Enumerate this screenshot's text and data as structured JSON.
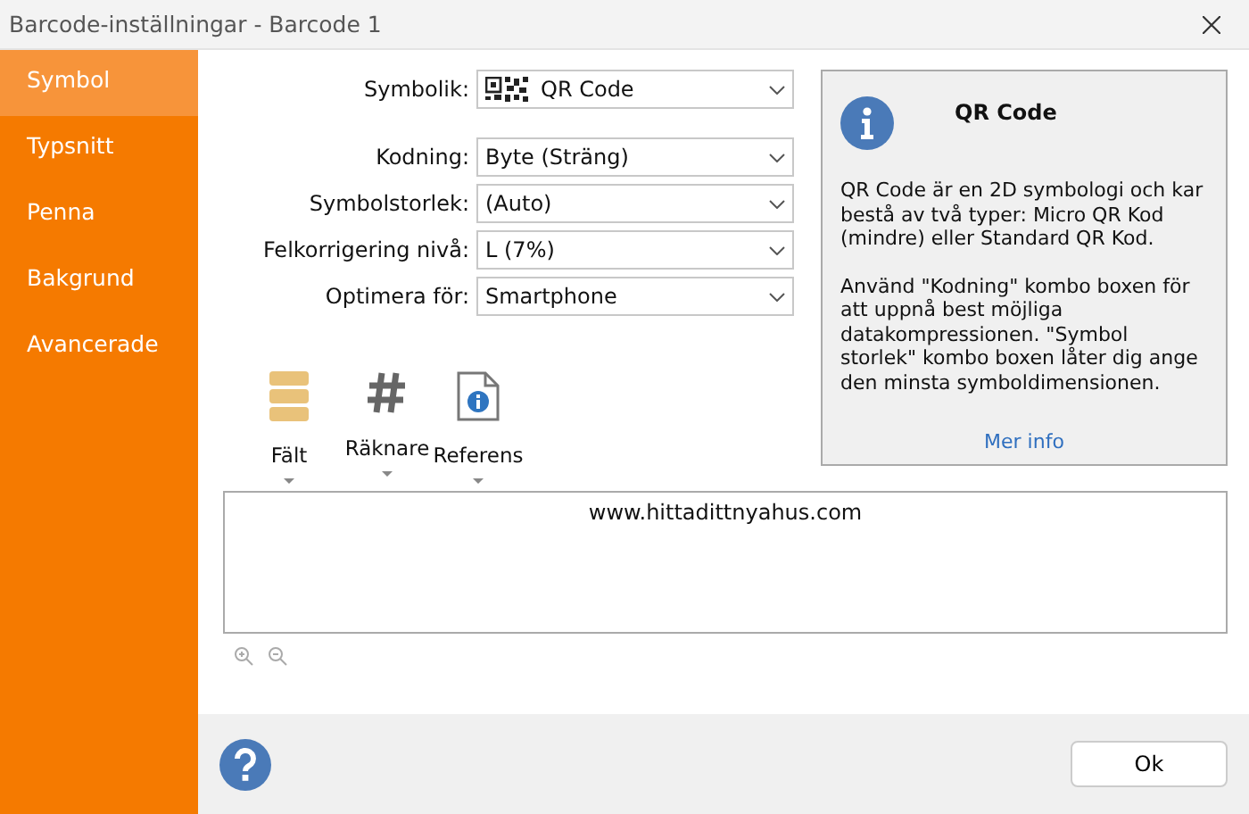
{
  "window": {
    "title": "Barcode-inställningar - Barcode 1"
  },
  "sidebar": {
    "items": [
      {
        "label": "Symbol",
        "selected": true
      },
      {
        "label": "Typsnitt",
        "selected": false
      },
      {
        "label": "Penna",
        "selected": false
      },
      {
        "label": "Bakgrund",
        "selected": false
      },
      {
        "label": "Avancerade",
        "selected": false
      }
    ]
  },
  "form": [
    {
      "kind": "symbology",
      "label": "Symbolik:",
      "value": "QR Code"
    },
    {
      "kind": "combo",
      "label": "Kodning:",
      "value": "Byte (Sträng)"
    },
    {
      "kind": "combo",
      "label": "Symbolstorlek:",
      "value": "(Auto)"
    },
    {
      "kind": "combo",
      "label": "Felkorrigering nivå:",
      "value": "L (7%)"
    },
    {
      "kind": "combo",
      "label": "Optimera för:",
      "value": "Smartphone"
    }
  ],
  "info": {
    "title": "QR Code",
    "paragraphs": [
      "QR Code är en 2D symbologi och kar bestå av två typer: Micro QR Kod (mindre) eller Standard QR Kod.",
      "Använd \"Kodning\" kombo boxen för att uppnå best möjliga datakompressionen.  \"Symbol storlek\" kombo boxen låter dig ange den minsta symboldimensionen."
    ],
    "link": "Mer info"
  },
  "toolbar": [
    {
      "kind": "field",
      "label": "Fält"
    },
    {
      "kind": "counter",
      "label": "Räknare"
    },
    {
      "kind": "reference",
      "label": "Referens"
    }
  ],
  "editor": {
    "value": "www.hittadittnyahus.com"
  },
  "buttons": [
    "Ok"
  ]
}
